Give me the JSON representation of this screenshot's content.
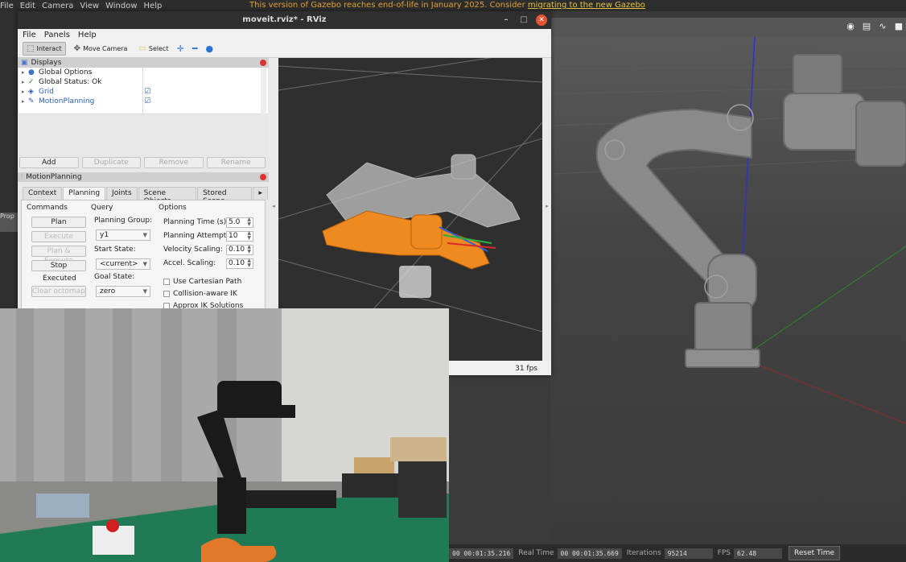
{
  "gazebo": {
    "menu": [
      "File",
      "Edit",
      "Camera",
      "View",
      "Window",
      "Help"
    ],
    "notice_text": "This version of Gazebo reaches end-of-life in January 2025. Consider ",
    "notice_link": "migrating to the new Gazebo",
    "left_strip_label": "Prop",
    "status": {
      "sim_time": "00 00:01:35.216",
      "real_time_label": "Real Time",
      "real_time": "00 00:01:35.669",
      "iterations_label": "Iterations",
      "iterations": "95214",
      "fps_label": "FPS",
      "fps": "62.48",
      "reset_label": "Reset Time"
    }
  },
  "rviz": {
    "title": "moveit.rviz* - RViz",
    "menu": [
      "File",
      "Panels",
      "Help"
    ],
    "tools": {
      "interact": "Interact",
      "move_camera": "Move Camera",
      "select": "Select"
    },
    "displays": {
      "title": "Displays",
      "items": [
        "Global Options",
        "Global Status: Ok",
        "Grid",
        "MotionPlanning"
      ],
      "buttons": {
        "add": "Add",
        "duplicate": "Duplicate",
        "remove": "Remove",
        "rename": "Rename"
      }
    },
    "motion_planning": {
      "title": "MotionPlanning",
      "tabs": [
        "Context",
        "Planning",
        "Joints",
        "Scene Objects",
        "Stored Scene"
      ],
      "commands_header": "Commands",
      "query_header": "Query",
      "options_header": "Options",
      "buttons": {
        "plan": "Plan",
        "execute": "Execute",
        "plan_execute": "Plan & Execute",
        "stop": "Stop",
        "clear_octomap": "Clear octomap"
      },
      "status": "Executed",
      "planning_group_label": "Planning Group:",
      "planning_group": "y1",
      "start_state_label": "Start State:",
      "start_state": "<current>",
      "goal_state_label": "Goal State:",
      "goal_state": "zero",
      "planning_time_label": "Planning Time (s):",
      "planning_time": "5.0",
      "planning_attempts_label": "Planning Attempts:",
      "planning_attempts": "10",
      "velocity_label": "Velocity Scaling:",
      "velocity": "0.10",
      "accel_label": "Accel. Scaling:",
      "accel": "0.10",
      "checks": [
        "Use Cartesian Path",
        "Collision-aware IK",
        "Approx IK Solutions"
      ]
    },
    "fps": "31 fps"
  }
}
